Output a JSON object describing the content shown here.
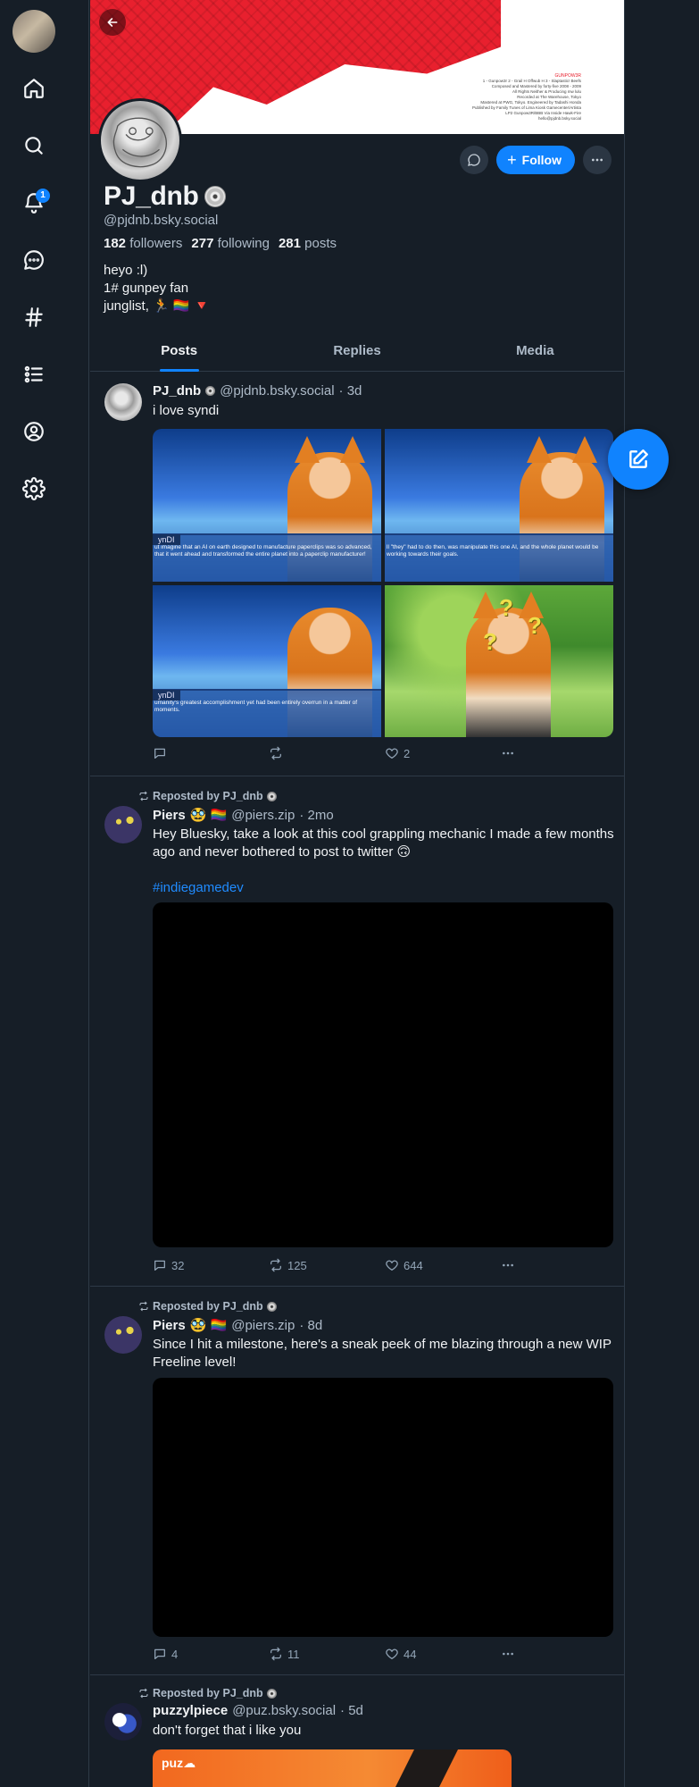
{
  "nav": {
    "items": [
      "home-icon",
      "search-icon",
      "bell-icon",
      "chat-icon",
      "hashtag-icon",
      "list-icon",
      "profile-icon",
      "settings-icon"
    ],
    "notification_count": "1"
  },
  "banner": {
    "credits_highlight": "GUNPOW3R",
    "credits_line1": "1 - Gunpow3r  2 - Grail H Offwub H  3 - Slaptastic! Beefs",
    "credits_lines": [
      "Composed and Mastered by forty-five 2008 - 2009",
      "All Rights Neither & Producing mw lulu",
      "Recorded at The Warehouse, Tokyo",
      "Mastered at PWG, Tokyo. Engineered by Tadashi Honda",
      "Published by Family Tunes of Lima Kiosk Gamecenter/Artista",
      "LP2 Gunpow3R/BBB Via Inside Hawk-Fire",
      "hello@pjdnb.bsky.social"
    ]
  },
  "profile": {
    "display_name": "PJ_dnb",
    "handle": "@pjdnb.bsky.social",
    "followers_count": "182",
    "followers_label": "followers",
    "following_count": "277",
    "following_label": "following",
    "posts_count": "281",
    "posts_label": "posts",
    "bio": [
      "heyo :l)",
      "1# gunpey fan",
      "junglist, 🏃 🏳️‍🌈 🔻"
    ],
    "follow_label": "Follow"
  },
  "tabs": [
    "Posts",
    "Replies",
    "Media"
  ],
  "colors": {
    "accent": "#1083fe",
    "background": "#161e27",
    "border": "#2e3a47",
    "muted": "#aebbc9"
  },
  "posts": [
    {
      "author": "PJ_dnb",
      "handle": "@pjdnb.bsky.social",
      "time": "· 3d",
      "text": "i love syndi",
      "images": [
        {
          "nametag": "ynDI",
          "caption": "ut imagine that an AI on earth designed to manufacture paperclips was so advanced, that it went ahead and transformed the entire planet into a paperclip manufacturer!"
        },
        {
          "nametag": "",
          "caption": "ll \"they\" had to do then, was manipulate this one AI, and the whole planet would be working towards their goals."
        },
        {
          "nametag": "ynDI",
          "caption": "umanity's greatest accomplishment yet had been entirely overrun in a matter of moments."
        },
        {
          "nametag": "",
          "caption": ""
        }
      ],
      "replies": "",
      "reposts": "",
      "likes": "2"
    },
    {
      "repost_by": "Reposted by PJ_dnb",
      "author": "Piers",
      "author_emoji": "🥸 🏳️‍🌈",
      "handle": "@piers.zip",
      "time": "· 2mo",
      "text": "Hey Bluesky, take a look at this cool grappling mechanic I made a few months ago and never bothered to post to twitter 🙃",
      "hashtag": "#indiegamedev",
      "replies": "32",
      "reposts": "125",
      "likes": "644"
    },
    {
      "repost_by": "Reposted by PJ_dnb",
      "author": "Piers",
      "author_emoji": "🥸 🏳️‍🌈",
      "handle": "@piers.zip",
      "time": "· 8d",
      "text": "Since I hit a milestone, here's a sneak peek of me blazing through a new WIP Freeline level!",
      "replies": "4",
      "reposts": "11",
      "likes": "44"
    },
    {
      "repost_by": "Reposted by PJ_dnb",
      "author": "puzzylpiece",
      "handle": "@puz.bsky.social",
      "time": "· 5d",
      "text": "don't forget that i like you",
      "card_logo": "puz☁"
    }
  ]
}
